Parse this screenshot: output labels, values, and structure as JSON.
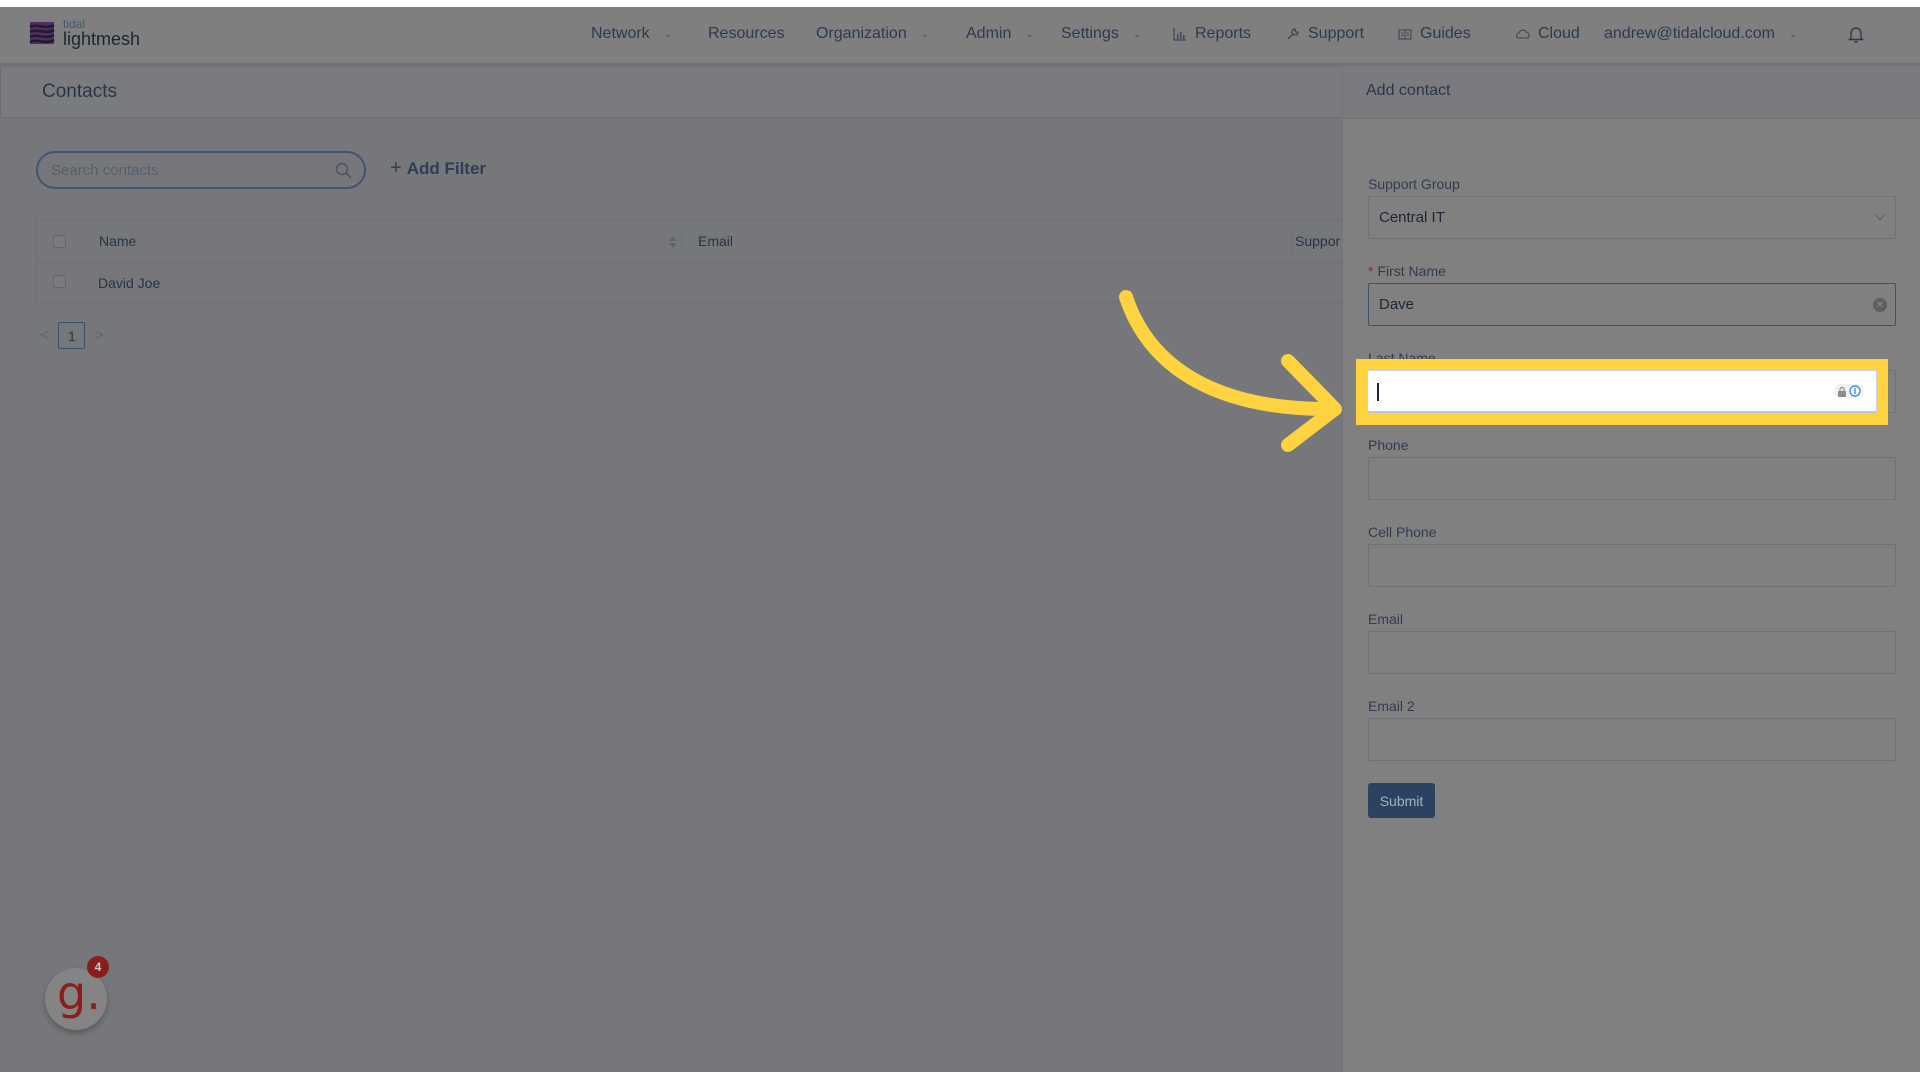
{
  "brand": {
    "small": "tidal",
    "big": "lightmesh"
  },
  "nav": {
    "items": [
      {
        "label": "Network",
        "dropdown": true
      },
      {
        "label": "Resources",
        "dropdown": false
      },
      {
        "label": "Organization",
        "dropdown": true
      },
      {
        "label": "Admin",
        "dropdown": true
      },
      {
        "label": "Settings",
        "dropdown": true
      },
      {
        "label": "Reports",
        "icon": "bar-chart-icon"
      },
      {
        "label": "Support",
        "icon": "wrench-icon"
      },
      {
        "label": "Guides",
        "icon": "book-icon"
      },
      {
        "label": "Cloud",
        "icon": "cloud-icon"
      }
    ],
    "user": "andrew@tidalcloud.com",
    "chevron": "⌄"
  },
  "page": {
    "title": "Contacts",
    "search_placeholder": "Search contacts",
    "add_filter": "Add Filter",
    "add_filter_plus": "+",
    "table": {
      "columns": [
        "Name",
        "Email",
        "Suppor"
      ],
      "rows": [
        {
          "name": "David Joe",
          "email": "",
          "support": ""
        }
      ]
    },
    "pagination": {
      "prev": "<",
      "current": "1",
      "next": ">"
    }
  },
  "drawer": {
    "title": "Add contact",
    "fields": {
      "support_group": {
        "label": "Support Group",
        "value": "Central IT"
      },
      "first_name": {
        "label": "First Name",
        "required_mark": "*",
        "value": "Dave"
      },
      "last_name": {
        "label": "Last Name",
        "value": ""
      },
      "phone": {
        "label": "Phone",
        "value": ""
      },
      "cell_phone": {
        "label": "Cell Phone",
        "value": ""
      },
      "email": {
        "label": "Email",
        "value": ""
      },
      "email2": {
        "label": "Email 2",
        "value": ""
      }
    },
    "submit": "Submit"
  },
  "guide_badge": {
    "letter": "g.",
    "count": "4"
  },
  "colors": {
    "highlight": "#ffd33f",
    "primary": "#2c4260",
    "brand_purple": "#6a2c79",
    "badge_red": "#8a1e1e"
  }
}
